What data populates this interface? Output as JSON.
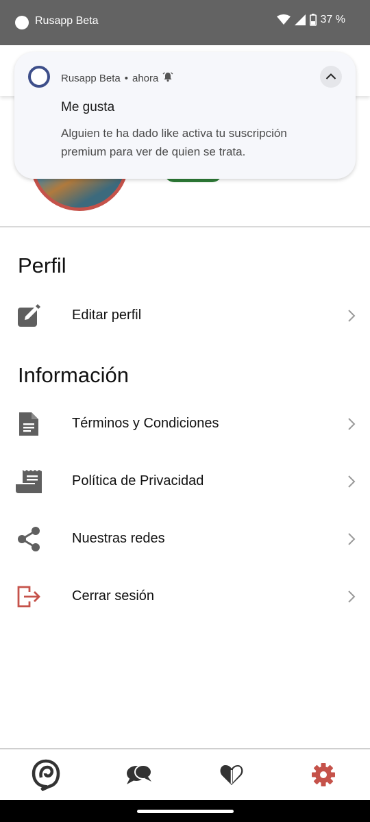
{
  "status_bar": {
    "app_name": "Rusapp Beta",
    "battery": "37 %",
    "icons": [
      "wifi-icon",
      "signal-icon",
      "battery-icon"
    ]
  },
  "notification": {
    "app_name": "Rusapp Beta",
    "time": "ahora",
    "separator": "•",
    "title": "Me gusta",
    "body": "Alguien te ha dado like activa tu suscripción premium para ver de quien se trata.",
    "icons": [
      "app-ring-icon",
      "alarm-bell-icon",
      "chevron-up-icon"
    ]
  },
  "sections": {
    "perfil": {
      "title": "Perfil",
      "items": [
        {
          "label": "Editar perfil",
          "icon": "edit-icon"
        }
      ]
    },
    "informacion": {
      "title": "Información",
      "items": [
        {
          "label": "Términos y Condiciones",
          "icon": "document-icon"
        },
        {
          "label": "Política de Privacidad",
          "icon": "receipt-icon"
        },
        {
          "label": "Nuestras redes",
          "icon": "share-icon"
        },
        {
          "label": "Cerrar sesión",
          "icon": "logout-icon"
        }
      ]
    }
  },
  "bottom_nav": {
    "items": [
      {
        "icon": "app-logo-icon",
        "active": false
      },
      {
        "icon": "chat-icon",
        "active": false
      },
      {
        "icon": "heart-icon",
        "active": false
      },
      {
        "icon": "settings-gear-icon",
        "active": true
      }
    ]
  },
  "colors": {
    "status_bar_bg": "#636363",
    "accent_red": "#c5524a",
    "icon_gray": "#5f5f5f",
    "green": "#2f7d38",
    "notification_ring": "#3e4f8a"
  }
}
